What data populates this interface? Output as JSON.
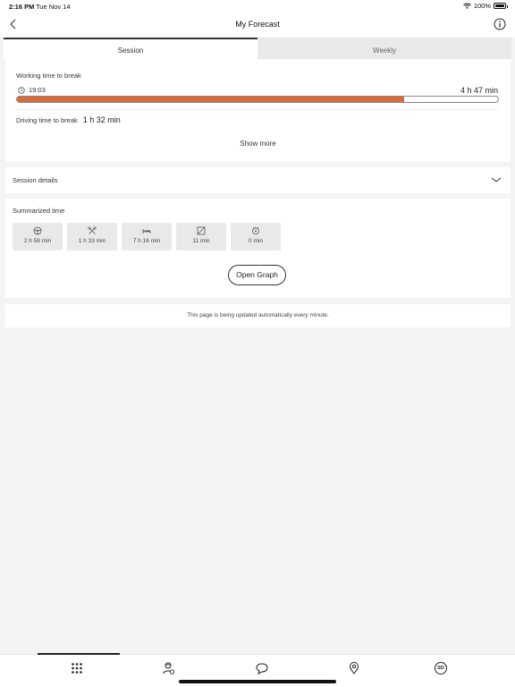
{
  "status_bar": {
    "time": "2:16 PM",
    "date": "Tue Nov 14",
    "battery": "100%"
  },
  "nav": {
    "title": "My Forecast"
  },
  "tabs": [
    {
      "label": "Session",
      "active": true
    },
    {
      "label": "Weekly",
      "active": false
    }
  ],
  "working": {
    "label": "Working time to break",
    "clock_time": "19:03",
    "value": "4 h 47 min",
    "progress_fraction": 0.805,
    "bar_color": "#d66a3c"
  },
  "driving": {
    "label": "Driving time to break",
    "value": "1 h 32 min"
  },
  "show_more": "Show more",
  "session_details": {
    "label": "Session details"
  },
  "summarized": {
    "label": "Summarized time",
    "tiles": [
      {
        "icon": "steering-wheel-icon",
        "value": "2 h 58 min"
      },
      {
        "icon": "crossed-tools-icon",
        "value": "1 h 33 min"
      },
      {
        "icon": "bed-icon",
        "value": "7 h 16 min"
      },
      {
        "icon": "availability-icon",
        "value": "11 min"
      },
      {
        "icon": "wheel-alert-icon",
        "value": "0 min"
      }
    ],
    "open_graph": "Open Graph"
  },
  "update_note": "This page is being updated automatically every minute.",
  "bottom_nav": [
    {
      "icon": "apps-grid-icon"
    },
    {
      "icon": "driver-icon"
    },
    {
      "icon": "chat-icon"
    },
    {
      "icon": "location-icon"
    },
    {
      "icon": "sd-icon",
      "label": "SD"
    }
  ]
}
